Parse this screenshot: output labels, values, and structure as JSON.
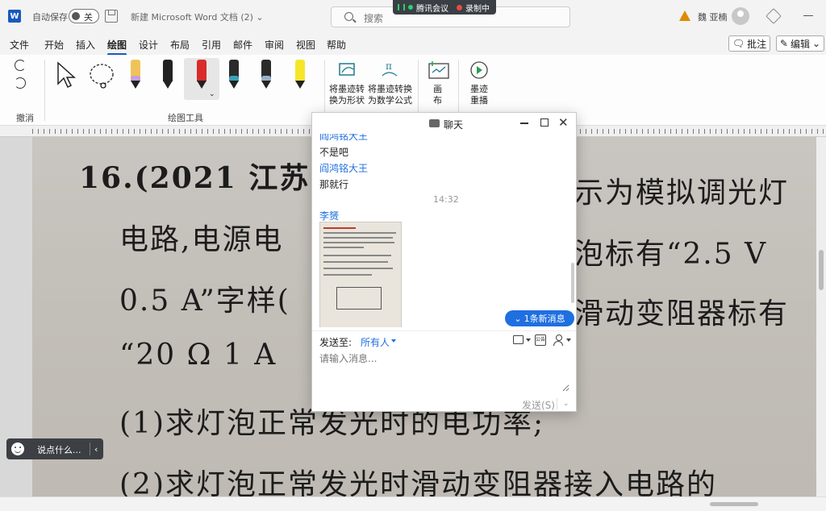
{
  "titlebar": {
    "autosave_label": "自动保存",
    "toggle_state": "关",
    "doc_title": "新建 Microsoft Word 文档 (2) ⌄",
    "search_placeholder": "搜索",
    "meeting_app": "腾讯会议",
    "recording": "录制中",
    "user_name": "魏 亚楠"
  },
  "menu": {
    "tabs": [
      "文件",
      "开始",
      "插入",
      "绘图",
      "设计",
      "布局",
      "引用",
      "邮件",
      "审阅",
      "视图",
      "帮助"
    ],
    "active": "绘图",
    "comment_label": "批注",
    "edit_label": "编辑"
  },
  "ribbon": {
    "undo_group": "撤消",
    "tools_group": "绘图工具",
    "ink_to_shape": "将墨迹转\n换为形状",
    "ink_to_math": "将墨迹转换\n为数学公式",
    "canvas": "画\n布",
    "replay": "墨迹\n重播",
    "pens": [
      {
        "cap": "#c89de0",
        "body": "#f0c35a"
      },
      {
        "cap": "#222222",
        "body": "#222222"
      },
      {
        "cap": "#d92b2b",
        "body": "#d92b2b"
      },
      {
        "cap": "#3aa0b8",
        "body": "#2a2a2a"
      },
      {
        "cap": "#9ab0c8",
        "body": "#2a2a2a"
      },
      {
        "cap": "#f5e62a",
        "body": "#f5e62a"
      }
    ]
  },
  "document": {
    "lines": [
      "16.(2021 江苏扌",
      "电路,电源电",
      "0.5 A”字样(",
      "“20 Ω   1 A",
      "(1)求灯泡正常发光时的电功率;",
      "(2)求灯泡正常发光时滑动变阻器接入电路的"
    ],
    "lines_right": [
      "示为模拟调光灯",
      "泡标有“2.5 V",
      "滑动变阻器标有"
    ]
  },
  "say_pill": {
    "text": "说点什么..."
  },
  "chat": {
    "title": "聊天",
    "messages": [
      {
        "sender": "阎鸿铭大王",
        "text": "不是吧"
      },
      {
        "sender": "阎鸿铭大王",
        "text": "那就行"
      }
    ],
    "time": "14:32",
    "image_sender": "李赟",
    "new_msg": "1条新消息",
    "send_to_label": "发送至:",
    "send_to_value": "所有人",
    "input_placeholder": "请输入消息...",
    "send_label": "发送(S)",
    "pub_icon_text": "公告"
  }
}
